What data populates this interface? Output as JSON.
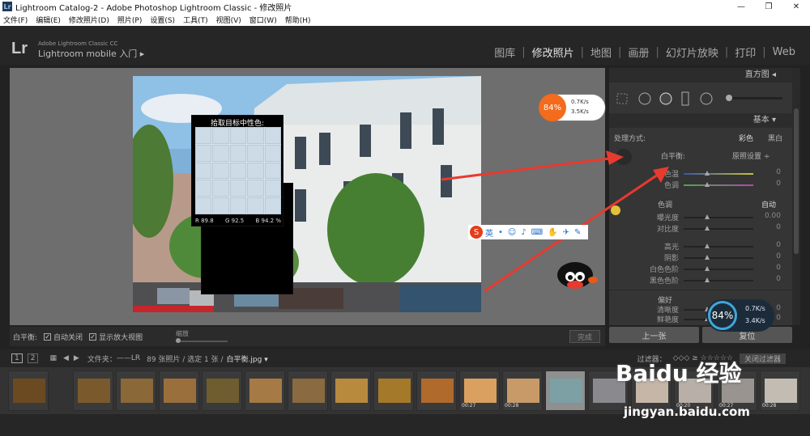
{
  "window": {
    "title": "Lightroom Catalog-2 - Adobe Photoshop Lightroom Classic - 修改照片",
    "app_icon": "Lr",
    "controls": [
      "—",
      "❐",
      "✕"
    ]
  },
  "menu": [
    "文件(F)",
    "编辑(E)",
    "修改照片(D)",
    "照片(P)",
    "设置(S)",
    "工具(T)",
    "视图(V)",
    "窗口(W)",
    "帮助(H)"
  ],
  "identity": {
    "logo": "Lr",
    "product": "Adobe Lightroom Classic CC",
    "mobile": "Lightroom mobile 入门  ▸"
  },
  "modules": [
    "图库",
    "修改照片",
    "地图",
    "画册",
    "幻灯片放映",
    "打印",
    "Web"
  ],
  "active_module": "修改照片",
  "loupe": {
    "title": "拾取目标中性色:",
    "r": "R  89.8",
    "g": "G  92.5",
    "b": "B  94.2  %"
  },
  "toolbar": {
    "wb_label": "白平衡:",
    "auto_close": "自动关闭",
    "show_loupe": "显示放大视图",
    "zoom_label": "缩放",
    "done": "完成"
  },
  "right_panel": {
    "histogram": "直方图",
    "basic": "基本",
    "treatment_label": "处理方式:",
    "treatment_color": "彩色",
    "treatment_bw": "黑白",
    "wb_label": "白平衡:",
    "wb_value": "原照设置 ÷",
    "temp": {
      "label": "色温",
      "value": "0"
    },
    "tint": {
      "label": "色调",
      "value": "0"
    },
    "tone_section": "色调",
    "tone_auto": "自动",
    "exposure": {
      "label": "曝光度",
      "value": "0.00"
    },
    "contrast": {
      "label": "对比度",
      "value": "0"
    },
    "highlights": {
      "label": "高光",
      "value": "0"
    },
    "shadows": {
      "label": "阴影",
      "value": "0"
    },
    "whites": {
      "label": "白色色阶",
      "value": "0"
    },
    "blacks": {
      "label": "黑色色阶",
      "value": "0"
    },
    "presence_section": "偏好",
    "clarity": {
      "label": "清晰度",
      "value": "0"
    },
    "vibrance": {
      "label": "鲜艳度",
      "value": "0"
    }
  },
  "panel_buttons": {
    "previous": "上一张",
    "reset": "复位"
  },
  "filmstrip_bar": {
    "page1": "1",
    "page2": "2",
    "folder_label": "文件夹：",
    "folder_path": "——LR",
    "count": "89 张照片 / 选定 1 张 /",
    "filename": "白平衡.jpg ▾",
    "filter_label": "过滤器：",
    "filter_off": "关闭过滤器"
  },
  "thumb_badges": [
    "00:27",
    "00:28",
    "00:20",
    "00:27",
    "00:28"
  ],
  "net_widget": {
    "percent": "84%",
    "up": "0.7K/s",
    "down": "3.5K/s"
  },
  "net_widget2": {
    "percent": "84%",
    "up": "0.7K/s",
    "down": "3.4K/s"
  },
  "ime": {
    "logo": "S",
    "mode": "英"
  },
  "watermark": {
    "brand": "Baidu 经验",
    "url": "jingyan.baidu.com"
  },
  "colors": {
    "accent": "#f36b1c",
    "arrow": "#e83a2f",
    "panel_bg": "#353535"
  }
}
